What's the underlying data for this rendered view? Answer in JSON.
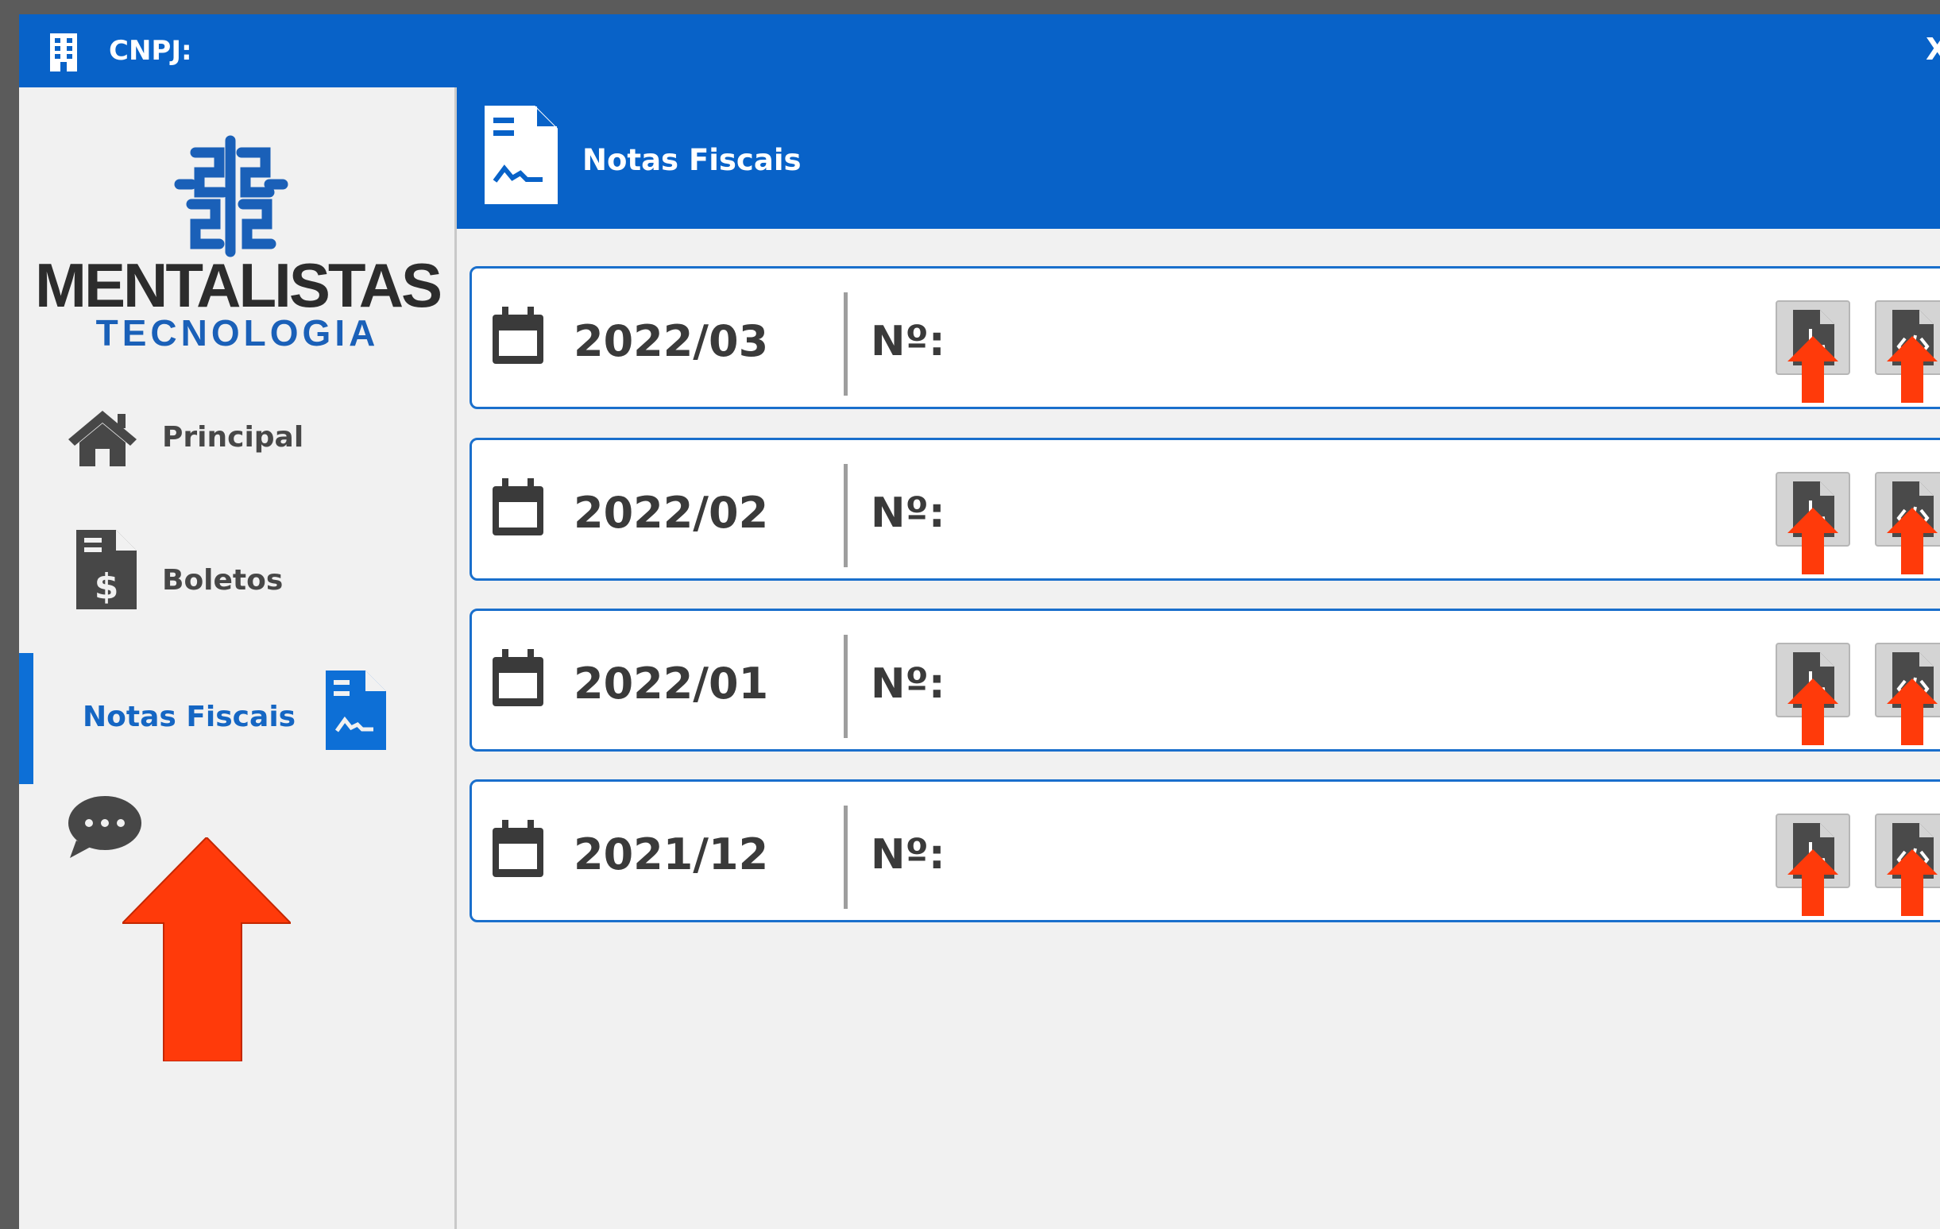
{
  "titlebar": {
    "title": "CNPJ:",
    "close_label": "X",
    "building_icon": "building-icon"
  },
  "logo": {
    "mark_icon": "brain-logo-icon",
    "word": "MENTALISTAS",
    "sub": "TECNOLOGIA"
  },
  "sidebar": {
    "items": [
      {
        "label": "Principal",
        "icon": "home-icon"
      },
      {
        "label": "Boletos",
        "icon": "invoice-dollar-icon"
      },
      {
        "label": "Notas Fiscais",
        "icon": "invoice-signature-icon",
        "active": true
      },
      {
        "label": "",
        "icon": "chat-icon"
      }
    ]
  },
  "header": {
    "title": "Notas Fiscais",
    "icon": "invoice-signature-icon"
  },
  "notes": [
    {
      "period": "2022/03",
      "number_label": "Nº:"
    },
    {
      "period": "2022/02",
      "number_label": "Nº:"
    },
    {
      "period": "2022/01",
      "number_label": "Nº:"
    },
    {
      "period": "2021/12",
      "number_label": "Nº:"
    }
  ],
  "colors": {
    "brand": "#0862c8",
    "accent": "#0d6fd6",
    "arrow": "#ff3a0a"
  }
}
